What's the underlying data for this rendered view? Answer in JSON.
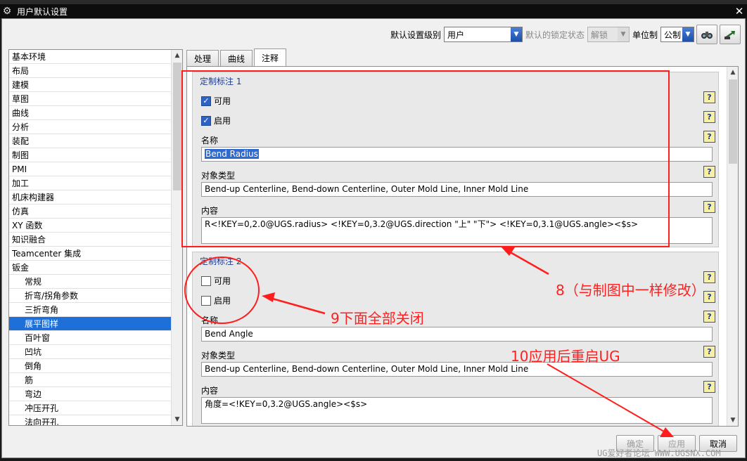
{
  "window": {
    "title": "用户默认设置",
    "close": "✕"
  },
  "toolbar": {
    "level_label": "默认设置级别",
    "level_value": "用户",
    "lock_label": "默认的锁定状态",
    "lock_value": "解锁",
    "unit_label": "单位制",
    "unit_value": "公制"
  },
  "tree": {
    "items": [
      "基本环境",
      "布局",
      "建模",
      "草图",
      "曲线",
      "分析",
      "装配",
      "制图",
      "PMI",
      "加工",
      "机床构建器",
      "仿真",
      "XY 函数",
      "知识融合",
      "Teamcenter 集成",
      "钣金"
    ],
    "sub_items": [
      "常规",
      "折弯/拐角参数",
      "三折弯角",
      "展平图样",
      "百叶窗",
      "凹坑",
      "倒角",
      "筋",
      "弯边",
      "冲压开孔",
      "法向开孔"
    ],
    "selected": "展平图样"
  },
  "tabs": [
    "处理",
    "曲线",
    "注释"
  ],
  "group1": {
    "title": "定制标注 1",
    "available": "可用",
    "enabled": "启用",
    "name_label": "名称",
    "name_value": "Bend Radius",
    "type_label": "对象类型",
    "type_value": "Bend-up Centerline, Bend-down Centerline, Outer Mold Line, Inner Mold Line",
    "content_label": "内容",
    "content_value": "R<!KEY=0,2.0@UGS.radius> <!KEY=0,3.2@UGS.direction \"上\" \"下\"> <!KEY=0,3.1@UGS.angle><$s>"
  },
  "group2": {
    "title": "定制标注 2",
    "available": "可用",
    "enabled": "启用",
    "name_label": "名称",
    "name_value": "Bend Angle",
    "type_label": "对象类型",
    "type_value": "Bend-up Centerline, Bend-down Centerline, Outer Mold Line, Inner Mold Line",
    "content_label": "内容",
    "content_value": "角度=<!KEY=0,3.2@UGS.angle><$s>"
  },
  "help_glyph": "?",
  "buttons": {
    "ok": "确定",
    "apply": "应用",
    "cancel": "取消"
  },
  "annotations": {
    "a8": "8（与制图中一样修改）",
    "a9": "9下面全部关闭",
    "a10": "10应用后重启UG"
  },
  "watermark": "UG爱好者论坛 WWW.UGSNX.COM",
  "colors": {
    "annotation": "#ff1d1d",
    "selection": "#1e6fd8",
    "group_title": "#1d3a93"
  }
}
